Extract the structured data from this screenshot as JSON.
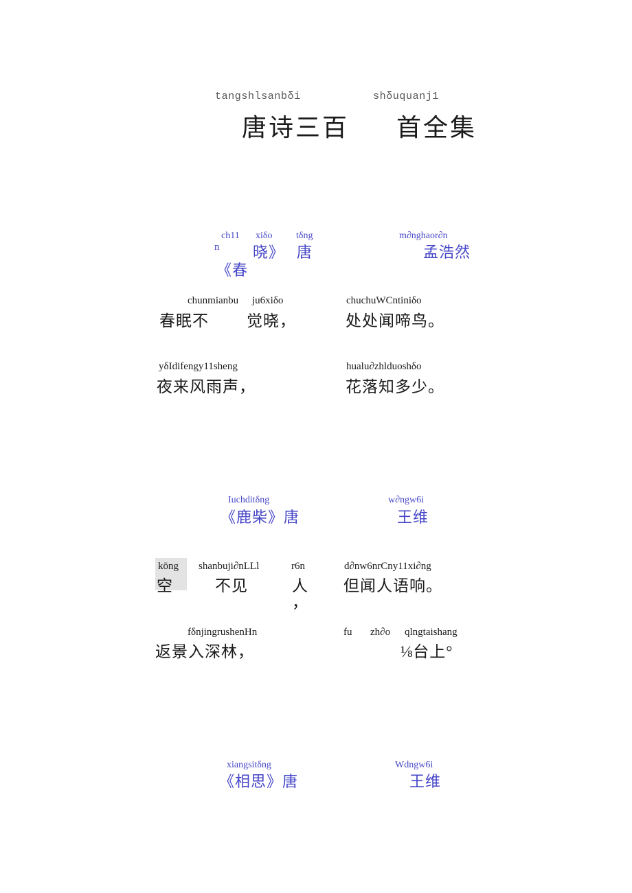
{
  "document": {
    "title": {
      "pinyin_left": "tangshlsanbδi",
      "han_left": "唐诗三百",
      "pinyin_right": "shδuquanj1",
      "han_right": "首全集"
    }
  },
  "poems": [
    {
      "id": "chunxiao",
      "heading": {
        "title_pinyin_top": "ch11",
        "title_pinyin_mid": "xiδo",
        "title_pinyin_dyn": "tδng",
        "title_han_prefix": "n",
        "title_han_mid": "晓》",
        "title_han_dyn": "唐",
        "title_han_open": "《春",
        "author_pinyin": "m∂nghaor∂n",
        "author_han": "孟浩然"
      },
      "lines": [
        {
          "left_pinyin_a": "chunmianbu",
          "left_pinyin_b": "ju6xiδo",
          "left_han_a": "春眠不",
          "left_han_b": "觉晓，",
          "right_pinyin": "chuchuWCntiniδo",
          "right_han": "处处闻啼鸟。"
        },
        {
          "left_pinyin_a": "yδIdifengy11sheng",
          "left_pinyin_b": "",
          "left_han_a": "夜来风雨声，",
          "left_han_b": "",
          "right_pinyin": "hualu∂zhlduoshδo",
          "right_han": "花落知多少。"
        }
      ]
    },
    {
      "id": "luzhai",
      "heading": {
        "title_pinyin": "Iuchditδng",
        "title_han": "《鹿柴》唐",
        "author_pinyin": "w∂ngw6i",
        "author_han": "王维"
      },
      "lines": [
        {
          "hl_pinyin": "kōng",
          "hl_han": "空",
          "left_pinyin_a": "shanbuji∂nLLl",
          "left_pinyin_b": "r6n",
          "left_han_a": "不见",
          "left_han_b": "人",
          "left_han_c": "，",
          "right_pinyin": "d∂nw6nrCny11xi∂ng",
          "right_han": "但闻人语响。"
        },
        {
          "left_pinyin_a": "fδnjingrushenHn",
          "left_han_a": "返景入深林，",
          "right_pinyin_a": "fu",
          "right_pinyin_b": "zh∂o",
          "right_pinyin_c": "qlngtaishang",
          "right_han": "⅛台上°"
        }
      ]
    },
    {
      "id": "xiangsi",
      "heading": {
        "title_pinyin": "xiangsitδng",
        "title_han": "《相思》唐",
        "author_pinyin": "Wdngw6i",
        "author_han": "王维"
      }
    }
  ],
  "colors": {
    "heading": "#4646c8",
    "body": "#1a1a1a",
    "title_pinyin": "#555555",
    "highlight": "#e3e3e3",
    "page_background": "#ffffff"
  }
}
